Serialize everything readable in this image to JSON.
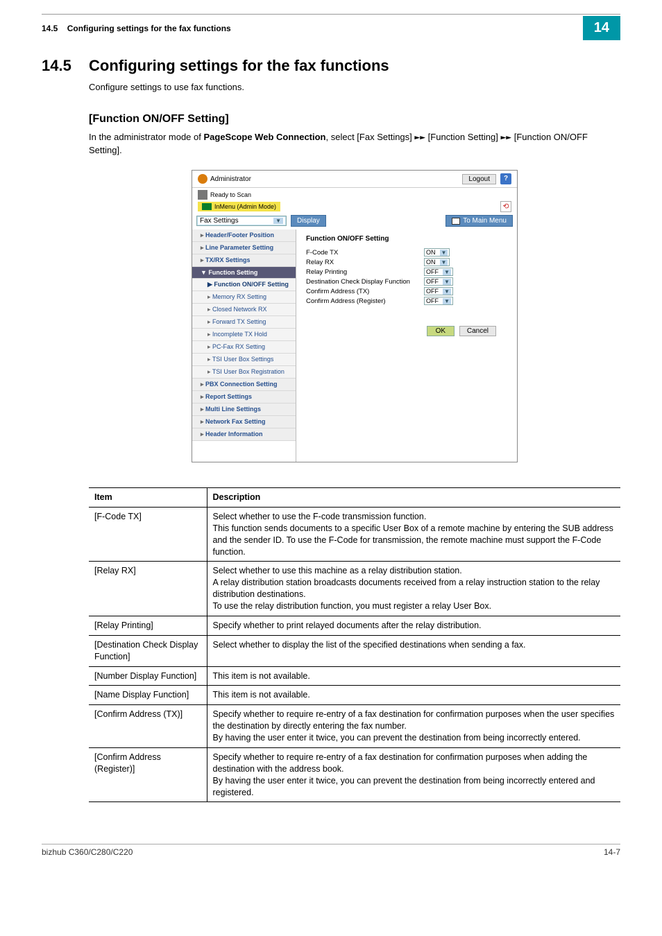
{
  "header": {
    "section_no": "14.5",
    "breadcrumb": "Configuring settings for the fax functions",
    "chapter_badge": "14"
  },
  "section": {
    "number": "14.5",
    "title": "Configuring settings for the fax functions",
    "intro": "Configure settings to use fax functions."
  },
  "subsection": {
    "heading": "[Function ON/OFF Setting]",
    "desc_前": "In the administrator mode of ",
    "desc_bold": "PageScope Web Connection",
    "desc_后": ", select [Fax Settings] ",
    "desc_中": " [Function Setting] ",
    "desc_end": " [Function ON/OFF Setting].",
    "arrow": "►►"
  },
  "shot": {
    "admin_label": "Administrator",
    "logout": "Logout",
    "help": "?",
    "status1": "Ready to Scan",
    "status2": "InMenu (Admin Mode)",
    "refresh_glyph": "⟲",
    "fax_settings": "Fax Settings",
    "display": "Display",
    "to_main": "To Main Menu",
    "panel_title": "Function ON/OFF Setting",
    "fields": [
      {
        "label": "F-Code TX",
        "value": "ON"
      },
      {
        "label": "Relay RX",
        "value": "ON"
      },
      {
        "label": "Relay Printing",
        "value": "OFF"
      },
      {
        "label": "Destination Check Display Function",
        "value": "OFF"
      },
      {
        "label": "Confirm Address (TX)",
        "value": "OFF"
      },
      {
        "label": "Confirm Address (Register)",
        "value": "OFF"
      }
    ],
    "ok": "OK",
    "cancel": "Cancel",
    "nav": {
      "header_footer": "Header/Footer Position",
      "line_param": "Line Parameter Setting",
      "txrx": "TX/RX Settings",
      "func_setting": "Function Setting",
      "func_onoff": "Function ON/OFF Setting",
      "memory_rx": "Memory RX Setting",
      "closed_net": "Closed Network RX",
      "forward_tx": "Forward TX Setting",
      "incomplete": "Incomplete TX Hold",
      "pcfax": "PC-Fax RX Setting",
      "tsi_box": "TSI User Box Settings",
      "tsi_reg": "TSI User Box Registration",
      "pbx": "PBX Connection Setting",
      "report": "Report Settings",
      "multi": "Multi Line Settings",
      "netfax": "Network Fax Setting",
      "header_info": "Header Information"
    }
  },
  "table": {
    "head_item": "Item",
    "head_desc": "Description",
    "rows": [
      {
        "item": "[F-Code TX]",
        "desc": "Select whether to use the F-code transmission function.\nThis function sends documents to a specific User Box of a remote machine by entering the SUB address and the sender ID. To use the F-Code for transmission, the remote machine must support the F-Code function."
      },
      {
        "item": "[Relay RX]",
        "desc": "Select whether to use this machine as a relay distribution station.\nA relay distribution station broadcasts documents received from a relay instruction station to the relay distribution destinations.\nTo use the relay distribution function, you must register a relay User Box."
      },
      {
        "item": "[Relay Printing]",
        "desc": "Specify whether to print relayed documents after the relay distribution."
      },
      {
        "item": "[Destination Check Display Function]",
        "desc": "Select whether to display the list of the specified destinations when sending a fax."
      },
      {
        "item": "[Number Display Function]",
        "desc": "This item is not available."
      },
      {
        "item": "[Name Display Function]",
        "desc": "This item is not available."
      },
      {
        "item": "[Confirm Address (TX)]",
        "desc": "Specify whether to require re-entry of a fax destination for confirmation purposes when the user specifies the destination by directly entering the fax number.\nBy having the user enter it twice, you can prevent the destination from being incorrectly entered."
      },
      {
        "item": "[Confirm Address (Register)]",
        "desc": "Specify whether to require re-entry of a fax destination for confirmation purposes when adding the destination with the address book.\nBy having the user enter it twice, you can prevent the destination from being incorrectly entered and registered."
      }
    ]
  },
  "footer": {
    "model": "bizhub C360/C280/C220",
    "page": "14-7"
  }
}
